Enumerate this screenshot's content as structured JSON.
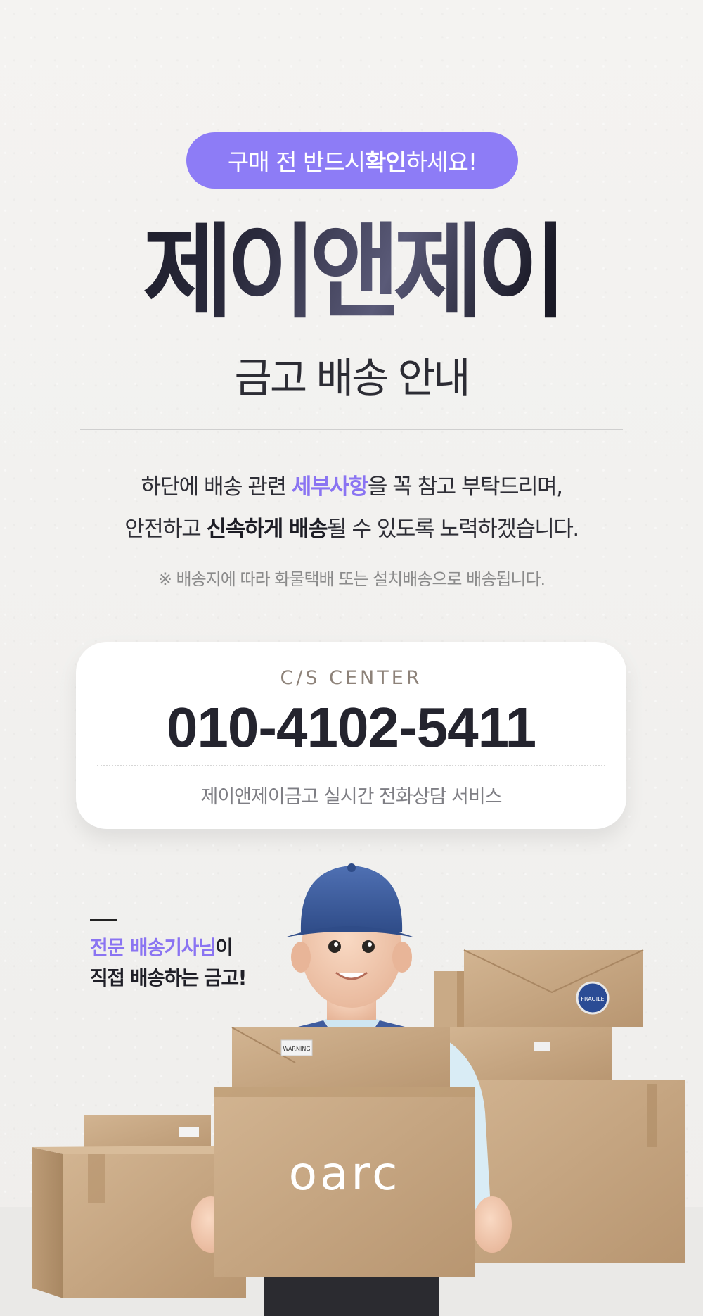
{
  "banner": {
    "prefix": "구매 전 반드시 ",
    "emphasis": "확인",
    "suffix": "하세요!"
  },
  "brand_title": "제이앤제이",
  "subtitle": "금고 배송 안내",
  "description": {
    "line1_a": "하단에 배송 관련 ",
    "line1_accent": "세부사항",
    "line1_b": "을 꼭 참고 부탁드리며,",
    "line2_a": "안전하고 ",
    "line2_bold": "신속하게 배송",
    "line2_b": "될 수 있도록 노력하겠습니다."
  },
  "note": "※ 배송지에 따라 화물택배 또는 설치배송으로 배송됩니다.",
  "cs": {
    "label": "C/S CENTER",
    "phone": "010-4102-5411",
    "service": "제이앤제이금고 실시간 전화상담 서비스"
  },
  "side_caption": {
    "accent": "전문 배송기사님",
    "line1_rest": "이",
    "line2": "직접 배송하는 금고!"
  },
  "box_labels": {
    "logo": "oarc",
    "warning": "WARNING",
    "fragile": "FRAGILE"
  },
  "colors": {
    "accent": "#8d7cf6",
    "cap": "#3d5b9a",
    "vest": "#3f5c9e",
    "box": "#c9a882"
  }
}
